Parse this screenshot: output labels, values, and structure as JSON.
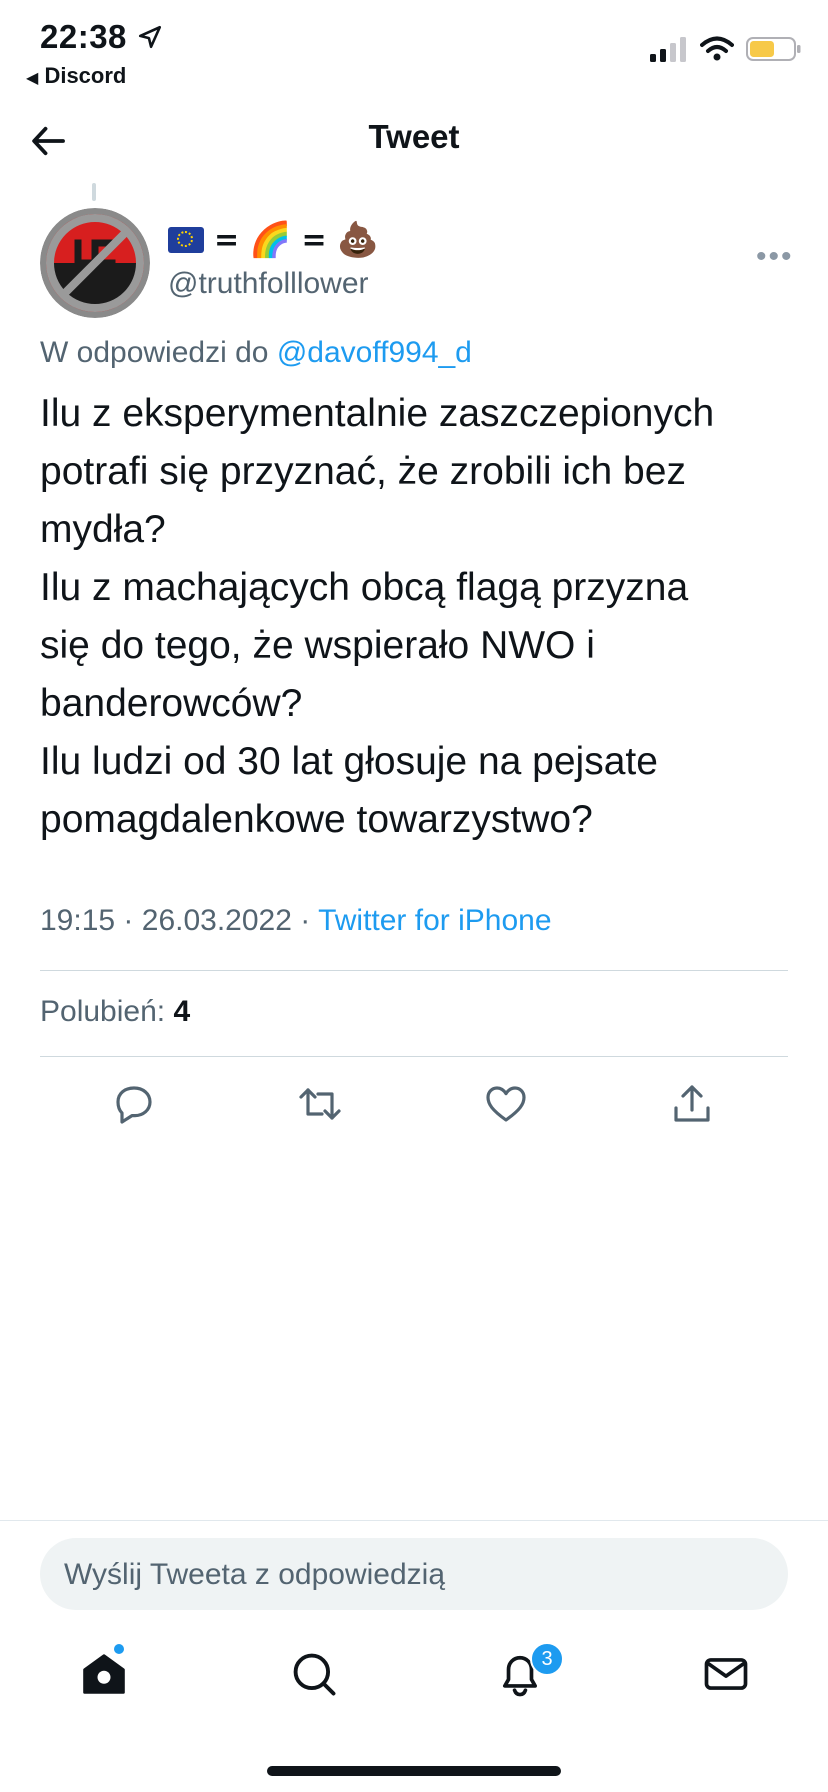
{
  "status_bar": {
    "time": "22:38",
    "back_app": "Discord"
  },
  "nav": {
    "title": "Tweet"
  },
  "tweet": {
    "display_name_parts": {
      "eq1": "=",
      "emoji_rainbow": "🌈",
      "eq2": "=",
      "emoji_poop": "💩"
    },
    "handle": "@truthfolllower",
    "reply_prefix": "W odpowiedzi do",
    "reply_to": "@davoff994_d",
    "text": "Ilu z eksperymentalnie zaszczepionych\npotrafi się przyznać, że zrobili ich bez\nmydła?\nIlu z machających obcą flagą przyzna\nsię do tego, że wspierało NWO i\nbanderowców?\nIlu ludzi od 30 lat głosuje na pejsate\npomagdalenkowe towarzystwo?",
    "time": "19:15",
    "date": "26.03.2022",
    "sep": "·",
    "source": "Twitter for iPhone",
    "likes_label": "Polubień:",
    "likes_count": "4"
  },
  "composer": {
    "placeholder": "Wyślij Tweeta z odpowiedzią"
  },
  "tabbar": {
    "notifications_badge": "3"
  },
  "colors": {
    "accent": "#1d9bf0",
    "muted": "#536471",
    "text": "#0f1419"
  }
}
